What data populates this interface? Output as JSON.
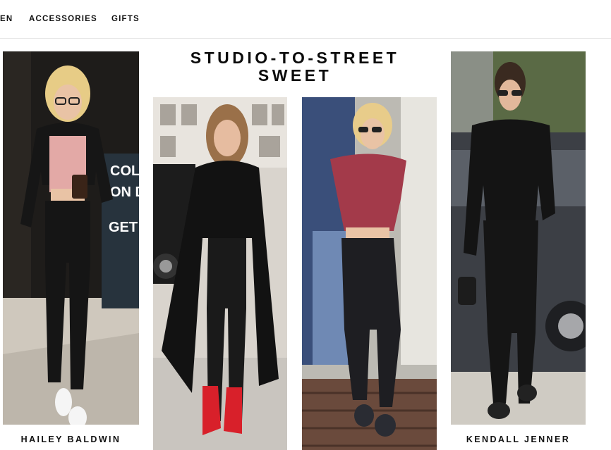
{
  "nav": {
    "items": [
      {
        "label": "EN"
      },
      {
        "label": "ACCESSORIES"
      },
      {
        "label": "GIFTS"
      }
    ]
  },
  "headline": {
    "line1": "STUDIO-TO-STREET",
    "line2": "SWEET"
  },
  "photos": [
    {
      "caption": "HAILEY BALDWIN",
      "sign_text": [
        "COLD",
        "ON D",
        "GET I"
      ]
    },
    {
      "caption": ""
    },
    {
      "caption": ""
    },
    {
      "caption": "KENDALL JENNER"
    }
  ],
  "colors": {
    "text": "#111111",
    "divider": "#e6e6e6",
    "boots": "#d8202a",
    "crop_top": "#a33a4a"
  }
}
